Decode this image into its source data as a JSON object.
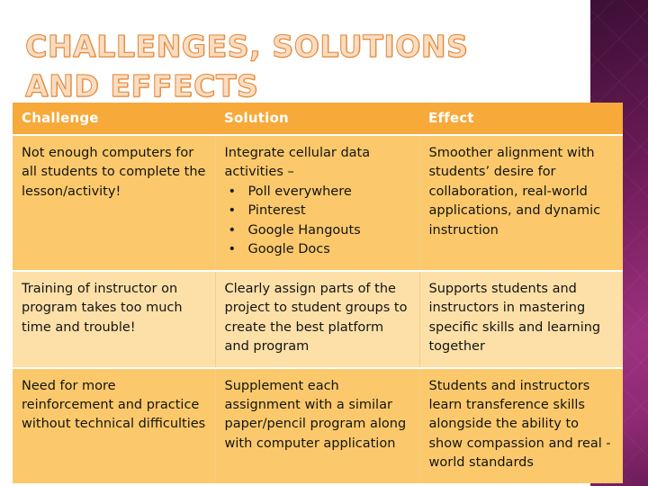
{
  "slide": {
    "title": "CHALLENGES, SOLUTIONS AND EFFECTS",
    "title_line1": "CHALLENGES, SOLUTIONS AND",
    "title_line2": "EFFECTS",
    "colors": {
      "title_fill": "#fbdcc1",
      "title_outline": "#e08a3c",
      "header_bg": "#f7a93a",
      "header_text": "#ffffff",
      "row_dark_bg": "#fbc96b",
      "row_light_bg": "#fde0a8",
      "body_text": "#141414",
      "band_dark": "#3d0f36",
      "band_bright": "#9c3180",
      "slide_bg": "#ffffff"
    }
  },
  "table": {
    "headers": {
      "challenge": "Challenge",
      "solution": "Solution",
      "effect": "Effect"
    },
    "rows": [
      {
        "shade": "dark",
        "challenge": "Not enough computers for all students to complete the lesson/activity!",
        "solution_lead": "Integrate cellular data activities –",
        "solution_bullets": [
          "Poll everywhere",
          "Pinterest",
          "Google Hangouts",
          "Google Docs"
        ],
        "effect": "Smoother alignment with students’ desire for collaboration, real-world applications, and dynamic instruction"
      },
      {
        "shade": "light",
        "challenge": "Training of instructor on program takes too much time and trouble!",
        "solution_lead": "Clearly assign parts of the project to student groups to create the best platform and program",
        "solution_bullets": [],
        "effect": "Supports students and instructors in mastering specific skills and learning together"
      },
      {
        "shade": "dark",
        "challenge": "Need for more reinforcement and practice without technical difficulties",
        "solution_lead": "Supplement each assignment with a similar paper/pencil program along with computer application",
        "solution_bullets": [],
        "effect": "Students and instructors learn transference skills alongside the ability to show compassion and real -world standards"
      }
    ]
  }
}
